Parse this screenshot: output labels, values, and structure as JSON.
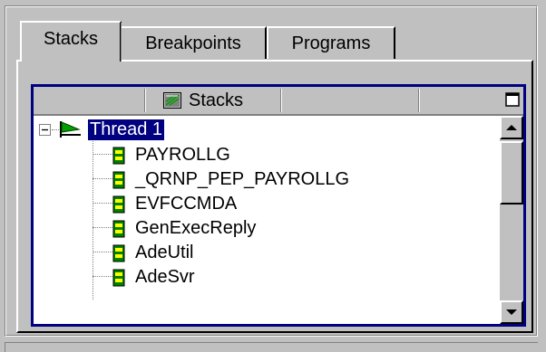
{
  "tabs": [
    {
      "label": "Stacks",
      "active": true
    },
    {
      "label": "Breakpoints",
      "active": false
    },
    {
      "label": "Programs",
      "active": false
    }
  ],
  "stacks_panel": {
    "header_title": "Stacks",
    "header_icon": "stack-icon",
    "maximize_icon": "maximize-icon"
  },
  "tree": {
    "root": {
      "label": "Thread 1",
      "expanded": true,
      "selected": true,
      "icon": "thread-flag-icon"
    },
    "children": [
      {
        "label": "PAYROLLG",
        "icon": "program-icon"
      },
      {
        "label": "_QRNP_PEP_PAYROLLG",
        "icon": "program-icon"
      },
      {
        "label": "EVFCCMDA",
        "icon": "program-icon"
      },
      {
        "label": "GenExecReply",
        "icon": "program-icon"
      },
      {
        "label": "AdeUtil",
        "icon": "program-icon"
      },
      {
        "label": "AdeSvr",
        "icon": "program-icon"
      }
    ]
  },
  "colors": {
    "selection": "#000080",
    "panel_border": "#000080",
    "face": "#c0c0c0"
  }
}
